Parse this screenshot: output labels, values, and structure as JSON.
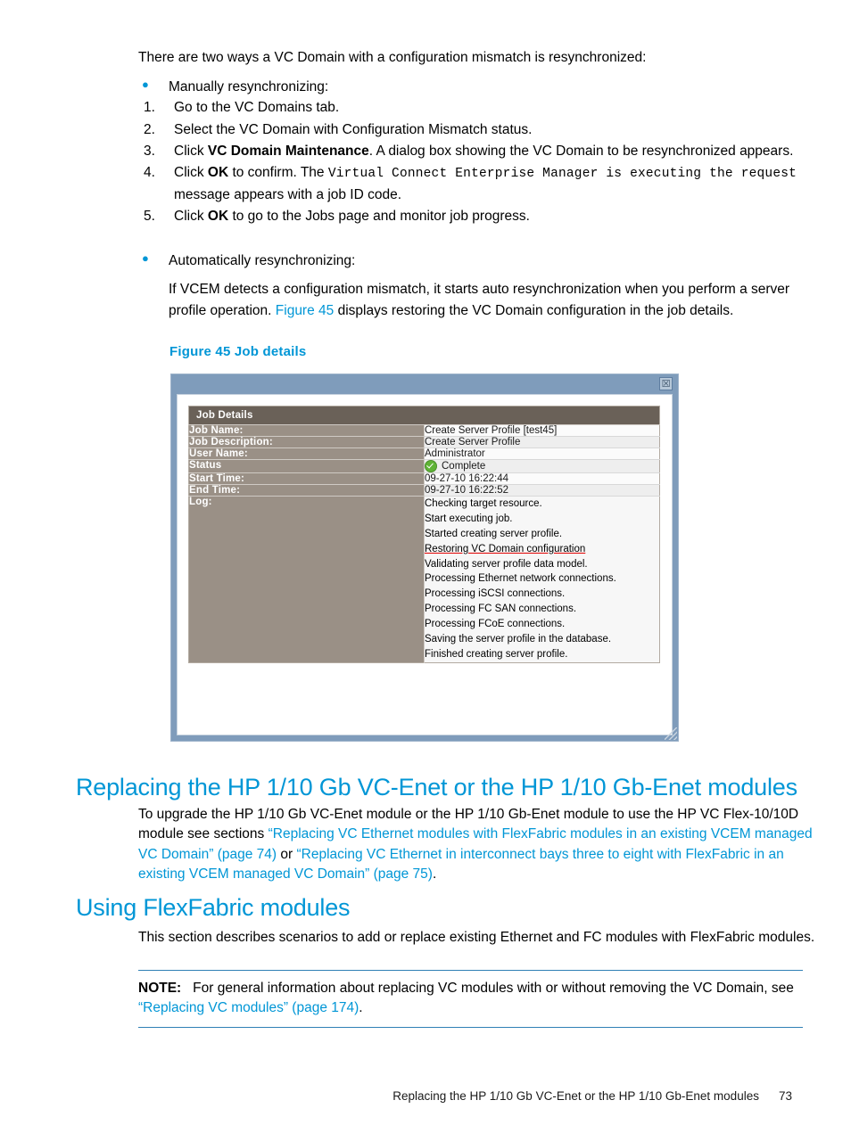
{
  "document": {
    "intro": "There are two ways a VC Domain with a configuration mismatch is resynchronized:",
    "bullets": [
      {
        "label": "Manually resynchronizing:",
        "steps": [
          {
            "num": "1.",
            "parts": [
              {
                "t": "Go to the VC Domains tab.",
                "s": "plain"
              }
            ]
          },
          {
            "num": "2.",
            "parts": [
              {
                "t": "Select the VC Domain with Configuration Mismatch status.",
                "s": "plain"
              }
            ]
          },
          {
            "num": "3.",
            "parts": [
              {
                "t": "Click ",
                "s": "plain"
              },
              {
                "t": "VC Domain Maintenance",
                "s": "bold"
              },
              {
                "t": ". A dialog box showing the VC Domain to be resynchronized appears.",
                "s": "plain"
              }
            ]
          },
          {
            "num": "4.",
            "parts": [
              {
                "t": "Click ",
                "s": "plain"
              },
              {
                "t": "OK",
                "s": "bold"
              },
              {
                "t": " to confirm. The ",
                "s": "plain"
              },
              {
                "t": "Virtual Connect Enterprise Manager is executing the request",
                "s": "mono"
              },
              {
                "t": " message appears with a job ID code.",
                "s": "plain"
              }
            ]
          },
          {
            "num": "5.",
            "parts": [
              {
                "t": "Click ",
                "s": "plain"
              },
              {
                "t": "OK",
                "s": "bold"
              },
              {
                "t": " to go to the Jobs page and monitor job progress.",
                "s": "plain"
              }
            ]
          }
        ]
      },
      {
        "label": "Automatically resynchronizing:",
        "paragraph_parts": [
          {
            "t": "If VCEM detects a configuration mismatch, it starts auto resynchronization when you perform a server profile operation. ",
            "s": "plain"
          },
          {
            "t": "Figure 45",
            "s": "xref"
          },
          {
            "t": " displays restoring the VC Domain configuration in the job details.",
            "s": "plain"
          }
        ]
      }
    ],
    "figure_caption": "Figure 45 Job details"
  },
  "figure": {
    "close_label": "☒",
    "table": {
      "header": "Job Details",
      "rows": [
        {
          "label": "Job Name:",
          "value": "Create Server Profile [test45]"
        },
        {
          "label": "Job Description:",
          "value": "Create Server Profile"
        },
        {
          "label": "User Name:",
          "value": "Administrator"
        },
        {
          "label": "Status",
          "value": "Complete",
          "icon": "status-complete-icon"
        },
        {
          "label": "Start Time:",
          "value": "09-27-10 16:22:44"
        },
        {
          "label": "End Time:",
          "value": "09-27-10 16:22:52"
        }
      ],
      "log_label": "Log:",
      "log_lines": [
        {
          "text": "Checking target resource.",
          "highlight": false
        },
        {
          "text": "Start executing job.",
          "highlight": false
        },
        {
          "text": "Started creating server profile.",
          "highlight": false
        },
        {
          "text": "Restoring VC Domain configuration",
          "highlight": true
        },
        {
          "text": "Validating server profile data model.",
          "highlight": false
        },
        {
          "text": "Processing Ethernet network connections.",
          "highlight": false
        },
        {
          "text": "Processing iSCSI connections.",
          "highlight": false
        },
        {
          "text": "Processing FC SAN connections.",
          "highlight": false
        },
        {
          "text": "Processing FCoE connections.",
          "highlight": false
        },
        {
          "text": "Saving the server profile in the database.",
          "highlight": false
        },
        {
          "text": "Finished creating server profile.",
          "highlight": false
        }
      ]
    }
  },
  "sections": [
    {
      "heading": "Replacing the HP 1/10 Gb VC-Enet or the HP 1/10 Gb-Enet modules",
      "parts": [
        {
          "t": "To upgrade the HP 1/10 Gb VC-Enet module or the HP 1/10 Gb-Enet module to use the HP VC Flex-10/10D module see sections ",
          "s": "plain"
        },
        {
          "t": "“Replacing VC Ethernet modules with FlexFabric modules in an existing VCEM managed VC Domain” (page 74)",
          "s": "xref"
        },
        {
          "t": " or ",
          "s": "plain"
        },
        {
          "t": "“Replacing VC Ethernet in interconnect bays three to eight with FlexFabric in an existing VCEM managed VC Domain” (page 75)",
          "s": "xref"
        },
        {
          "t": ".",
          "s": "plain"
        }
      ]
    },
    {
      "heading": "Using FlexFabric modules",
      "parts": [
        {
          "t": "This section describes scenarios to add or replace existing Ethernet and FC modules with FlexFabric modules.",
          "s": "plain"
        }
      ]
    }
  ],
  "note": {
    "label": "NOTE:",
    "parts": [
      {
        "t": "For general information about replacing VC modules with or without removing the VC Domain, see ",
        "s": "plain"
      },
      {
        "t": "“Replacing VC modules” (page 174)",
        "s": "xref"
      },
      {
        "t": ".",
        "s": "plain"
      }
    ]
  },
  "footer": {
    "text": "Replacing the HP 1/10 Gb VC-Enet or the HP 1/10 Gb-Enet modules",
    "page_number": "73"
  },
  "colors": {
    "accent_blue": "#0096d6",
    "rule_blue": "#2f7fb5",
    "dialog_chrome": "#7f9cbb",
    "table_header": "#6a6158",
    "table_label": "#9a9086",
    "status_green": "#5fb336",
    "highlight_red": "#e00000"
  }
}
